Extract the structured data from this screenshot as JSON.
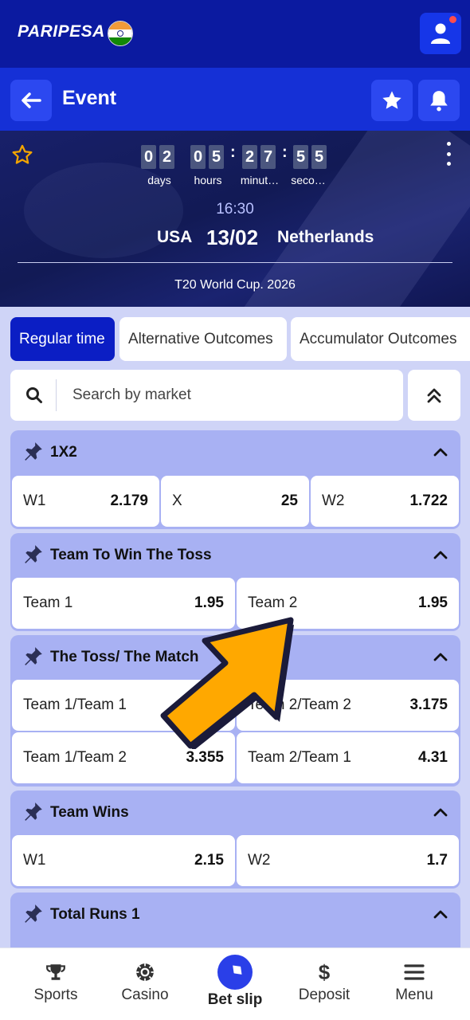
{
  "header": {
    "logo_text": "PARIPESA",
    "flag": "india-flag-icon"
  },
  "event_bar": {
    "title": "Event"
  },
  "hero": {
    "countdown": {
      "days": [
        "0",
        "2"
      ],
      "hours": [
        "0",
        "5"
      ],
      "minutes": [
        "2",
        "7"
      ],
      "seconds": [
        "5",
        "5"
      ],
      "labels": {
        "days": "days",
        "hours": "hours",
        "minutes": "minut…",
        "seconds": "seco…"
      }
    },
    "time": "16:30",
    "team_home": "USA",
    "date": "13/02",
    "team_away": "Netherlands",
    "league": "T20 World Cup. 2026"
  },
  "tabs": [
    "Regular time",
    "Alternative Outcomes",
    "Accumulator Outcomes"
  ],
  "search": {
    "placeholder": "Search by market"
  },
  "markets": [
    {
      "title": "1X2",
      "odds": [
        {
          "label": "W1",
          "value": "2.179"
        },
        {
          "label": "X",
          "value": "25"
        },
        {
          "label": "W2",
          "value": "1.722"
        }
      ]
    },
    {
      "title": "Team To Win The Toss",
      "odds": [
        {
          "label": "Team 1",
          "value": "1.95"
        },
        {
          "label": "Team 2",
          "value": "1.95"
        }
      ]
    },
    {
      "title": "The Toss/ The Match",
      "odds": [
        {
          "label": "Team 1/Team 1",
          "value": ""
        },
        {
          "label": "Team 2/Team 2",
          "value": "3.175"
        },
        {
          "label": "Team 1/Team 2",
          "value": "3.355"
        },
        {
          "label": "Team 2/Team 1",
          "value": "4.31"
        }
      ]
    },
    {
      "title": "Team Wins",
      "odds": [
        {
          "label": "W1",
          "value": "2.15"
        },
        {
          "label": "W2",
          "value": "1.7"
        }
      ]
    },
    {
      "title": "Total Runs 1",
      "odds": []
    }
  ],
  "bottom_nav": [
    {
      "label": "Sports",
      "icon": "trophy-icon"
    },
    {
      "label": "Casino",
      "icon": "casino-chip-icon"
    },
    {
      "label": "Bet slip",
      "icon": "ticket-icon"
    },
    {
      "label": "Deposit",
      "icon": "dollar-icon"
    },
    {
      "label": "Menu",
      "icon": "menu-icon"
    }
  ],
  "colors": {
    "primary": "#0b1aa0",
    "accent": "#1530d6",
    "market_bg": "#a8b1f3",
    "page_bg": "#cfd4f7",
    "arrow": "#ffa800"
  }
}
